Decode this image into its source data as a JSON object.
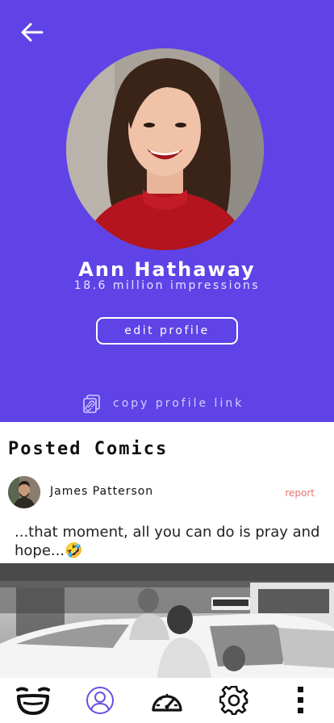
{
  "profile": {
    "name": "Ann Hathaway",
    "impressions": "18.6 million impressions",
    "edit_label": "edit profile",
    "copy_link_label": "copy profile link"
  },
  "posts_section": {
    "title": "Posted Comics"
  },
  "post": {
    "author": "James Patterson",
    "report_label": "report",
    "caption": "...that moment, all you can do is pray and hope...🤣"
  },
  "nav": {
    "items": [
      {
        "icon": "smile-icon",
        "active": false
      },
      {
        "icon": "profile-icon",
        "active": true
      },
      {
        "icon": "dashboard-icon",
        "active": false
      },
      {
        "icon": "gear-icon",
        "active": false
      },
      {
        "icon": "more-icon",
        "active": false
      }
    ]
  },
  "colors": {
    "header_bg": "#5f43e6",
    "report": "#e57373",
    "nav_active": "#6a4fe0",
    "nav_inactive": "#111111"
  }
}
